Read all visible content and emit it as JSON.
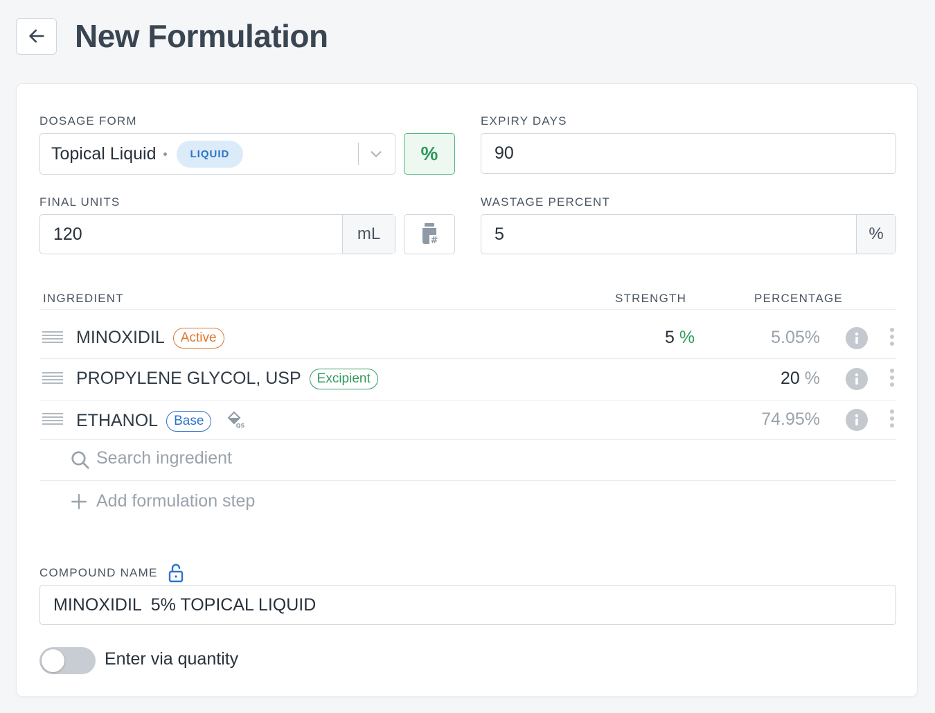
{
  "page": {
    "title": "New Formulation"
  },
  "form": {
    "dosage_form": {
      "label": "DOSAGE FORM",
      "value": "Topical Liquid",
      "chip": "LIQUID"
    },
    "percent_toggle_symbol": "%",
    "expiry_days": {
      "label": "EXPIRY DAYS",
      "value": "90"
    },
    "final_units": {
      "label": "FINAL UNITS",
      "value": "120",
      "unit": "mL"
    },
    "wastage_percent": {
      "label": "WASTAGE PERCENT",
      "value": "5",
      "unit": "%"
    }
  },
  "table": {
    "headers": {
      "ingredient": "INGREDIENT",
      "strength": "STRENGTH",
      "percentage": "PERCENTAGE"
    },
    "rows": [
      {
        "name": "MINOXIDIL",
        "tag": "Active",
        "strength": "5",
        "strength_unit": "%",
        "percentage": "5.05%"
      },
      {
        "name": "PROPYLENE GLYCOL, USP",
        "tag": "Excipient",
        "strength": "",
        "strength_unit": "",
        "percentage": "20",
        "percentage_unit": "%"
      },
      {
        "name": "ETHANOL",
        "tag": "Base",
        "strength": "",
        "strength_unit": "",
        "percentage": "74.95%"
      }
    ]
  },
  "search": {
    "placeholder": "Search ingredient"
  },
  "add_step": {
    "label": "Add formulation step"
  },
  "compound": {
    "label": "COMPOUND NAME",
    "value": "MINOXIDIL  5% TOPICAL LIQUID"
  },
  "quantity_toggle": {
    "label": "Enter via quantity",
    "on": false
  },
  "icons": {
    "back": "arrow-left-icon",
    "dropdown": "chevron-down-icon",
    "percent": "percent-icon",
    "bottle": "bottle-hash-icon",
    "drag": "drag-handle-icon",
    "info": "info-icon",
    "more": "more-vertical-icon",
    "qs": "paint-bucket-qs-icon",
    "search": "search-icon",
    "plus": "plus-icon",
    "lock": "lock-open-icon"
  },
  "colors": {
    "accent_green": "#2f9a5c",
    "accent_blue": "#2c73c9",
    "accent_orange": "#e0762f"
  }
}
